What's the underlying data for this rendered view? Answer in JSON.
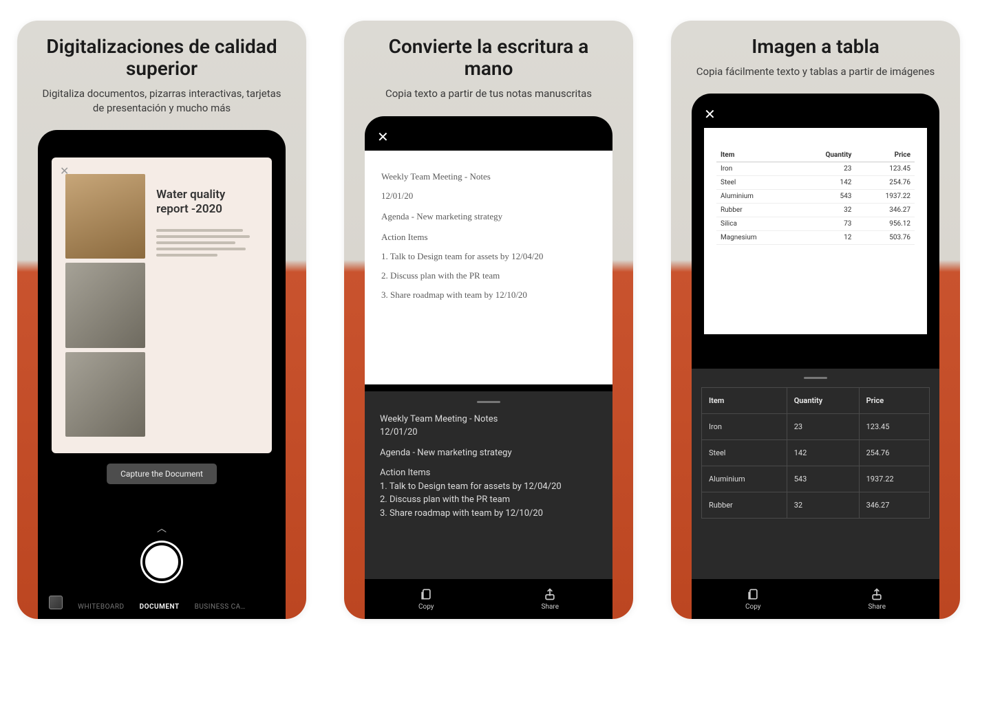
{
  "cards": [
    {
      "heading": "Digitalizaciones de calidad superior",
      "sub": "Digitaliza documentos, pizarras interactivas, tarjetas de presentación y mucho más",
      "doc_title": "Water quality report -2020",
      "capture_label": "Capture the Document",
      "modes": {
        "whiteboard": "WHITEBOARD",
        "document": "DOCUMENT",
        "business": "BUSINESS CA…"
      }
    },
    {
      "heading": "Convierte la escritura a mano",
      "sub": "Copia texto a partir de tus notas manuscritas",
      "handwriting": {
        "l1": "Weekly Team Meeting - Notes",
        "l2": "12/01/20",
        "l3": "Agenda - New marketing strategy",
        "l4": "Action Items",
        "l5": "1. Talk to Design team for assets by 12/04/20",
        "l6": "2. Discuss plan with the PR team",
        "l7": "3. Share roadmap with team by 12/10/20"
      },
      "ocr": {
        "l1": "Weekly Team Meeting - Notes",
        "l2": "12/01/20",
        "l3": "Agenda - New marketing strategy",
        "l4": "Action Items",
        "l5": "1. Talk to Design team for assets by 12/04/20",
        "l6": "2. Discuss plan with the PR team",
        "l7": "3. Share roadmap with team by 12/10/20"
      },
      "actions": {
        "copy": "Copy",
        "share": "Share"
      }
    },
    {
      "heading": "Imagen a tabla",
      "sub": "Copia fácilmente texto y tablas a partir de imágenes",
      "columns": {
        "item": "Item",
        "qty": "Quantity",
        "price": "Price"
      },
      "scan_rows": [
        {
          "item": "Iron",
          "qty": "23",
          "price": "123.45"
        },
        {
          "item": "Steel",
          "qty": "142",
          "price": "254.76"
        },
        {
          "item": "Aluminium",
          "qty": "543",
          "price": "1937.22"
        },
        {
          "item": "Rubber",
          "qty": "32",
          "price": "346.27"
        },
        {
          "item": "Silica",
          "qty": "73",
          "price": "956.12"
        },
        {
          "item": "Magnesium",
          "qty": "12",
          "price": "503.76"
        }
      ],
      "panel_rows": [
        {
          "item": "Iron",
          "qty": "23",
          "price": "123.45"
        },
        {
          "item": "Steel",
          "qty": "142",
          "price": "254.76"
        },
        {
          "item": "Aluminium",
          "qty": "543",
          "price": "1937.22"
        },
        {
          "item": "Rubber",
          "qty": "32",
          "price": "346.27"
        }
      ],
      "actions": {
        "copy": "Copy",
        "share": "Share"
      }
    }
  ]
}
